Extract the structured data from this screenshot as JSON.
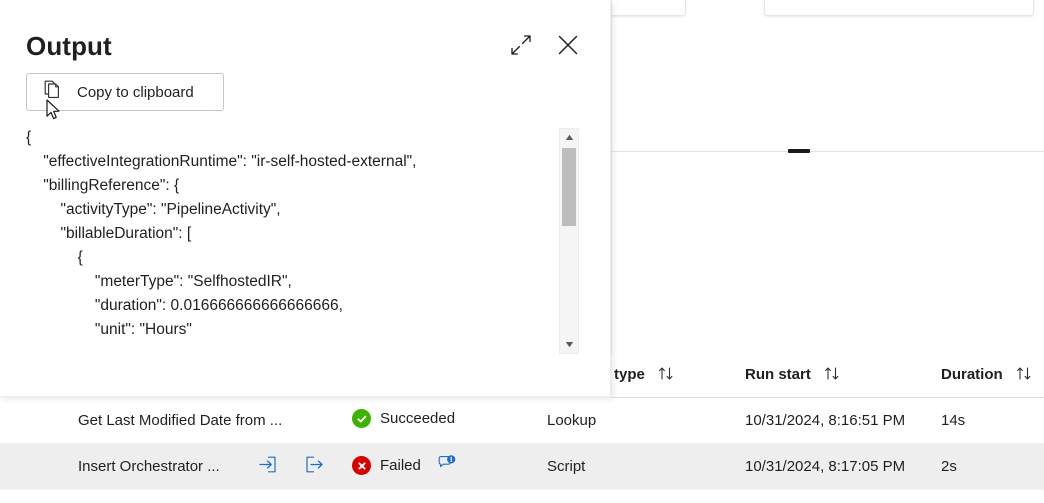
{
  "output_panel": {
    "title": "Output",
    "expand_icon": "expand-diagonal-icon",
    "close_icon": "close-icon",
    "copy_button_label": "Copy to clipboard",
    "copy_icon": "copy-pages-icon",
    "json_text": "{\n    \"effectiveIntegrationRuntime\": \"ir-self-hosted-external\",\n    \"billingReference\": {\n        \"activityType\": \"PipelineActivity\",\n        \"billableDuration\": [\n            {\n                \"meterType\": \"SelfhostedIR\",\n                \"duration\": 0.016666666666666666,\n                \"unit\": \"Hours\"",
    "json_fields": {
      "effectiveIntegrationRuntime": "ir-self-hosted-external",
      "billingReference": {
        "activityType": "PipelineActivity",
        "billableDuration": [
          {
            "meterType": "SelfhostedIR",
            "duration": 0.016666666666666666,
            "unit": "Hours"
          }
        ]
      }
    },
    "scrollbar": {
      "up_arrow": "▲",
      "down_arrow": "▼"
    }
  },
  "runs_table": {
    "columns": [
      {
        "label": "type",
        "sort_icon": "sort-updown-icon"
      },
      {
        "label": "Run start",
        "sort_icon": "sort-updown-icon"
      },
      {
        "label": "Duration",
        "sort_icon": "sort-up-icon"
      }
    ],
    "rows": [
      {
        "name": "Get Last Modified Date from ...",
        "status": "Succeeded",
        "status_kind": "success",
        "activity_type": "Lookup",
        "run_start": "10/31/2024, 8:16:51 PM",
        "duration": "14s",
        "has_io_icons": false,
        "has_comment_badge": false
      },
      {
        "name": "Insert Orchestrator ...",
        "status": "Failed",
        "status_kind": "error",
        "activity_type": "Script",
        "run_start": "10/31/2024, 8:17:05 PM",
        "duration": "2s",
        "has_io_icons": true,
        "input_icon": "input-arrow-icon",
        "output_icon": "output-arrow-icon",
        "has_comment_badge": true,
        "comment_badge_icon": "comment-alert-icon"
      }
    ]
  },
  "colors": {
    "success": "#3db300",
    "error": "#d90000",
    "link": "#0f6cbd",
    "text": "#201f1e",
    "row_alt": "#eeeeee",
    "border": "#e1dfdd"
  }
}
